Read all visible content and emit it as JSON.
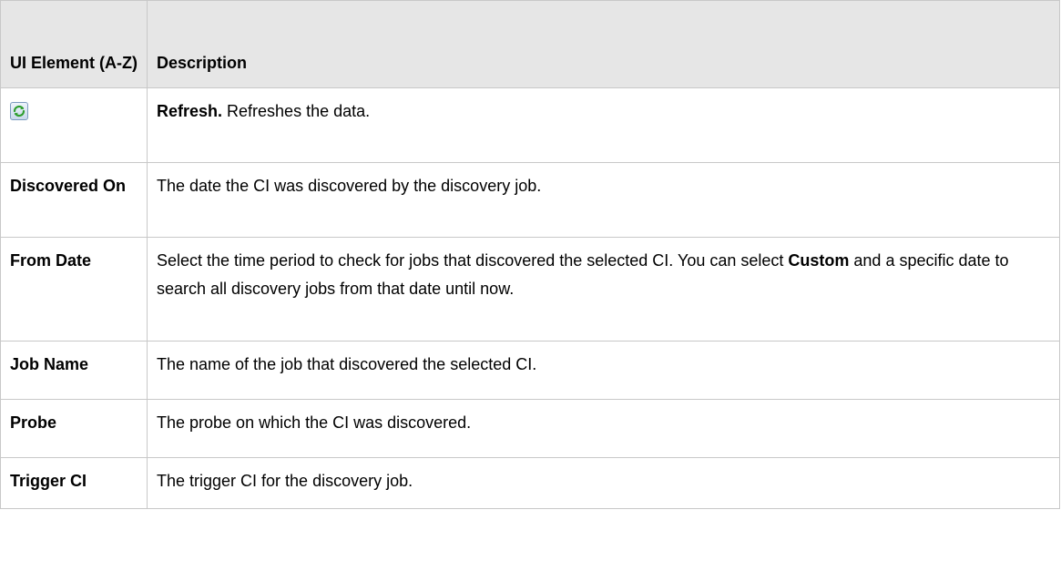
{
  "table": {
    "header": {
      "col1": "UI Element (A-Z)",
      "col2": "Description"
    },
    "rows": [
      {
        "icon": "refresh-icon",
        "desc_bold": "Refresh.",
        "desc_text": " Refreshes the data."
      },
      {
        "name": "Discovered On",
        "desc_text": "The date the CI was discovered by the discovery job."
      },
      {
        "name": "From Date",
        "desc_text_1": "Select the time period to check for jobs that discovered the selected CI. You can select ",
        "desc_bold": "Custom",
        "desc_text_2": " and a specific date to search all discovery jobs from that date until now."
      },
      {
        "name": "Job Name",
        "desc_text": "The name of the job that discovered the selected CI."
      },
      {
        "name": "Probe",
        "desc_text": "The probe on which the CI was discovered."
      },
      {
        "name": "Trigger CI",
        "desc_text": "The trigger CI for the discovery job."
      }
    ]
  },
  "colors": {
    "header_bg": "#e6e6e6",
    "border": "#c8c8c8",
    "refresh_icon_green": "#2e9e2e"
  }
}
